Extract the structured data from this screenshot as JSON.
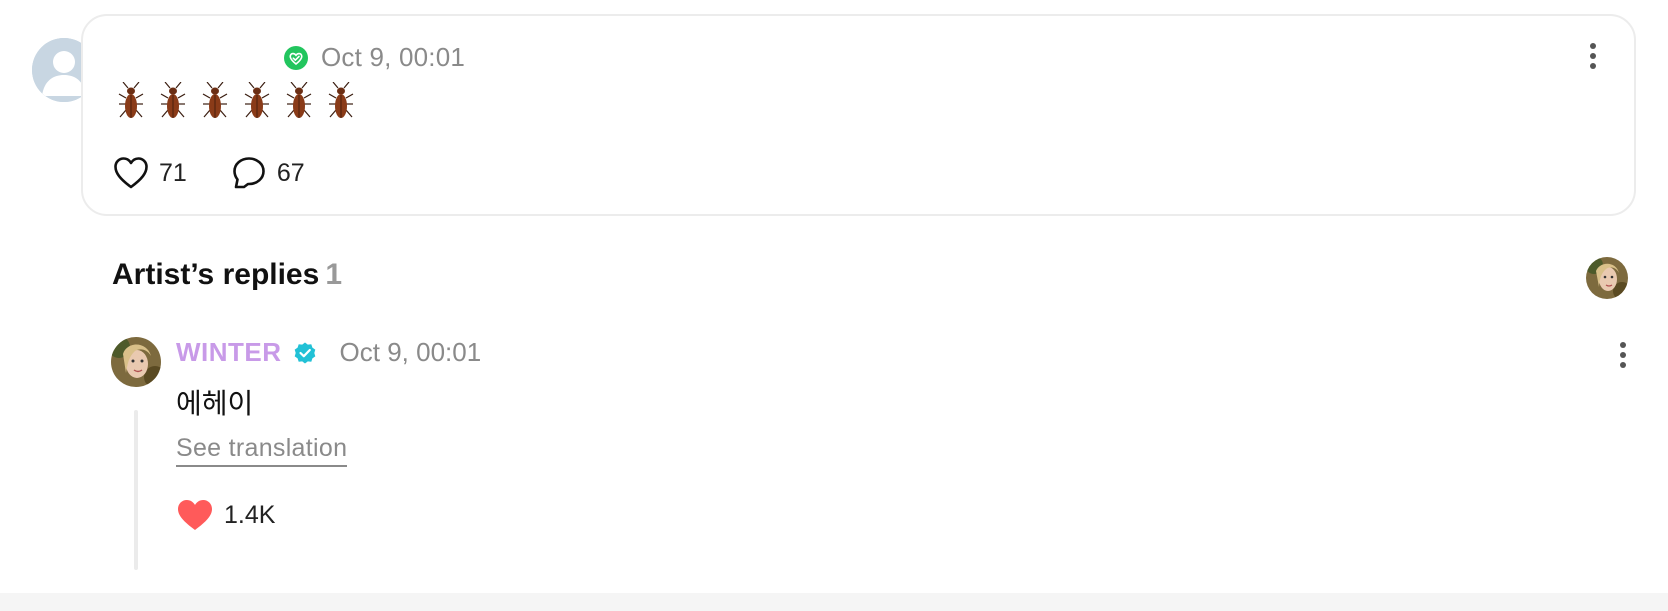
{
  "post": {
    "timestamp": "Oct 9, 00:01",
    "content_emoji": "🪳🪳🪳🪳🪳🪳",
    "like_count": "71",
    "comment_count": "67",
    "badge_color": "#22c55e"
  },
  "replies_section": {
    "title": "Artist’s replies",
    "count": "1"
  },
  "reply": {
    "author": "WINTER",
    "timestamp": "Oct 9, 00:01",
    "text": "에헤이",
    "translate_label": "See translation",
    "like_count": "1.4K",
    "author_color": "#c89ae8",
    "verified_color": "#22c1d6",
    "heart_color": "#ff5a5a"
  },
  "icons": {
    "post_badge": "verified-heart-icon",
    "post_menu": "more-vertical-icon",
    "like": "heart-outline-icon",
    "comment": "comment-bubble-icon",
    "verified": "verified-check-icon",
    "reply_menu": "more-vertical-icon",
    "reply_like": "heart-filled-icon"
  }
}
